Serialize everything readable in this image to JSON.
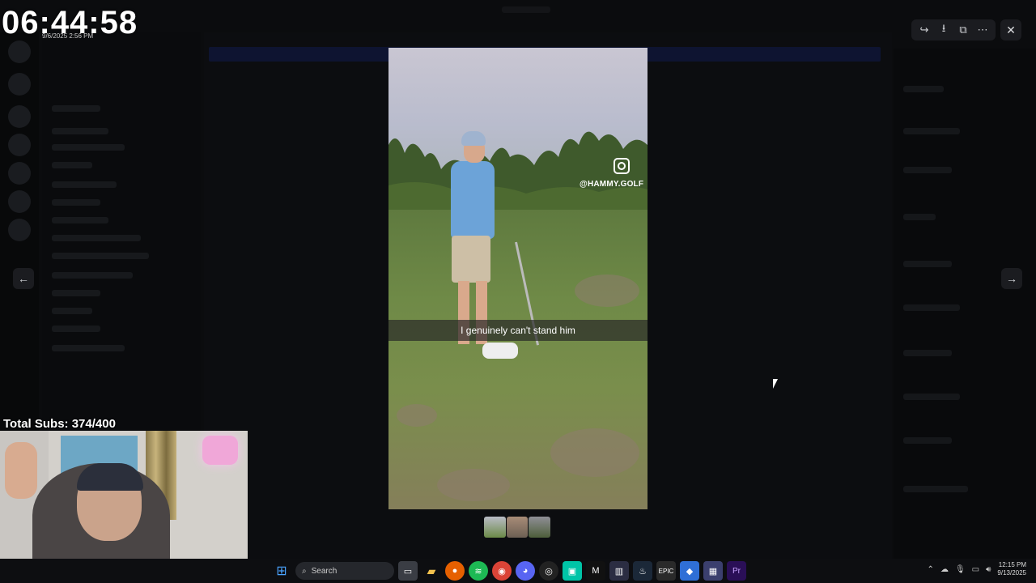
{
  "overlay": {
    "timer": "06:44:58",
    "timer_date": "9/6/2025 2:56 PM",
    "subs": "Total Subs: 374/400"
  },
  "viewer": {
    "caption": "I genuinely can't stand him",
    "watermark_handle": "@HAMMY.GOLF",
    "controls": {
      "share": "share-icon",
      "download": "download-icon",
      "open_external": "open-external-icon",
      "more": "more-icon",
      "close": "close-icon"
    }
  },
  "taskbar": {
    "search_label": "Search",
    "clock_time": "12:15 PM",
    "clock_date": "9/13/2025"
  },
  "colors": {
    "viewer_button_bg": "#1b1c20",
    "backdrop": "#050506",
    "taskbar": "#0d0e11"
  }
}
